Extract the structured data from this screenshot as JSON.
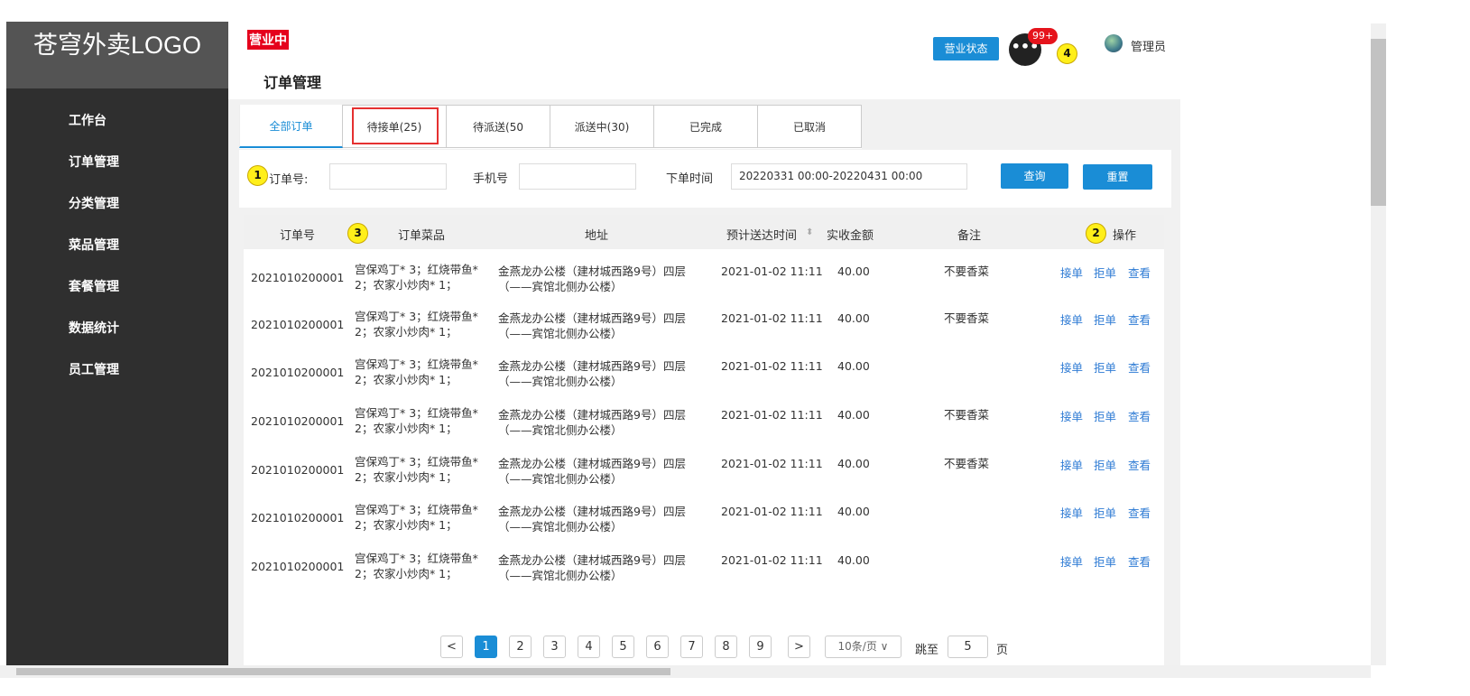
{
  "sidebar": {
    "logo": "苍穹外卖LOGO",
    "items": [
      {
        "label": "工作台"
      },
      {
        "label": "订单管理"
      },
      {
        "label": "分类管理"
      },
      {
        "label": "菜品管理"
      },
      {
        "label": "套餐管理"
      },
      {
        "label": "数据统计"
      },
      {
        "label": "员工管理"
      }
    ]
  },
  "header": {
    "status": "营业中",
    "page_title": "订单管理",
    "biz_button": "营业状态",
    "msg_icon_text": "•••",
    "msg_badge": "99+",
    "admin_name": "管理员"
  },
  "markers": {
    "m1": "1",
    "m2": "2",
    "m3": "3",
    "m4": "4"
  },
  "tabs": [
    {
      "label": "全部订单"
    },
    {
      "label": "待接单(25)"
    },
    {
      "label": "待派送(50"
    },
    {
      "label": "派送中(30)"
    },
    {
      "label": "已完成"
    },
    {
      "label": "已取消"
    }
  ],
  "filter": {
    "order_no_label": "订单号:",
    "order_no_value": "",
    "phone_label": "手机号",
    "phone_value": "",
    "time_label": "下单时间",
    "time_value": "20220331 00:00-20220431 00:00",
    "query_button": "查询",
    "reset_button": "重置"
  },
  "table": {
    "columns": [
      "订单号",
      "订单菜品",
      "地址",
      "预计送达时间",
      "实收金额",
      "备注",
      "操作"
    ],
    "sort_icon": "⬍",
    "rows": [
      {
        "order_no": "2021010200001",
        "dishes": "宫保鸡丁* 3；红烧带鱼* 2；农家小炒肉* 1；",
        "address": "金燕龙办公楼（建材城西路9号）四层（——宾馆北侧办公楼）",
        "time": "2021-01-02 11:11",
        "amount": "40.00",
        "remark": "不要香菜"
      },
      {
        "order_no": "2021010200001",
        "dishes": "宫保鸡丁* 3；红烧带鱼* 2；农家小炒肉* 1；",
        "address": "金燕龙办公楼（建材城西路9号）四层（——宾馆北侧办公楼）",
        "time": "2021-01-02 11:11",
        "amount": "40.00",
        "remark": "不要香菜"
      },
      {
        "order_no": "2021010200001",
        "dishes": "宫保鸡丁* 3；红烧带鱼* 2；农家小炒肉* 1；",
        "address": "金燕龙办公楼（建材城西路9号）四层（——宾馆北侧办公楼）",
        "time": "2021-01-02 11:11",
        "amount": "40.00",
        "remark": ""
      },
      {
        "order_no": "2021010200001",
        "dishes": "宫保鸡丁* 3；红烧带鱼* 2；农家小炒肉* 1；",
        "address": "金燕龙办公楼（建材城西路9号）四层（——宾馆北侧办公楼）",
        "time": "2021-01-02 11:11",
        "amount": "40.00",
        "remark": "不要香菜"
      },
      {
        "order_no": "2021010200001",
        "dishes": "宫保鸡丁* 3；红烧带鱼* 2；农家小炒肉* 1；",
        "address": "金燕龙办公楼（建材城西路9号）四层（——宾馆北侧办公楼）",
        "time": "2021-01-02 11:11",
        "amount": "40.00",
        "remark": "不要香菜"
      },
      {
        "order_no": "2021010200001",
        "dishes": "宫保鸡丁* 3；红烧带鱼* 2；农家小炒肉* 1；",
        "address": "金燕龙办公楼（建材城西路9号）四层（——宾馆北侧办公楼）",
        "time": "2021-01-02 11:11",
        "amount": "40.00",
        "remark": ""
      },
      {
        "order_no": "2021010200001",
        "dishes": "宫保鸡丁* 3；红烧带鱼* 2；农家小炒肉* 1；",
        "address": "金燕龙办公楼（建材城西路9号）四层（——宾馆北侧办公楼）",
        "time": "2021-01-02 11:11",
        "amount": "40.00",
        "remark": ""
      }
    ],
    "actions": {
      "accept": "接单",
      "reject": "拒单",
      "view": "查看"
    }
  },
  "pagination": {
    "prev": "<",
    "next": ">",
    "pages": [
      "1",
      "2",
      "3",
      "4",
      "5",
      "6",
      "7",
      "8",
      "9"
    ],
    "current": "1",
    "page_size": "10条/页",
    "jump_label": "跳至",
    "jump_value": "5",
    "page_suffix": "页"
  }
}
